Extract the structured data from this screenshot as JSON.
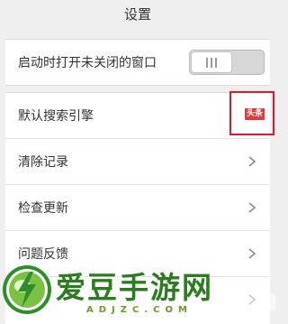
{
  "header": {
    "title": "设置"
  },
  "startup": {
    "label": "启动时打开未关闭的窗口",
    "toggle_on": false
  },
  "menu": {
    "search_engine": {
      "label": "默认搜索引擎",
      "value": "头条"
    },
    "clear_history": {
      "label": "清除记录"
    },
    "check_update": {
      "label": "检查更新"
    },
    "feedback": {
      "label": "问题反馈"
    }
  },
  "watermark": {
    "text": "爱豆手游网",
    "url": "ADJZC.COM"
  },
  "colors": {
    "background": "#efeff0",
    "row_background": "#ffffff",
    "highlight_box": "#e1192a",
    "engine_logo": "#e8363b",
    "watermark_green": "#2a7c1f"
  }
}
